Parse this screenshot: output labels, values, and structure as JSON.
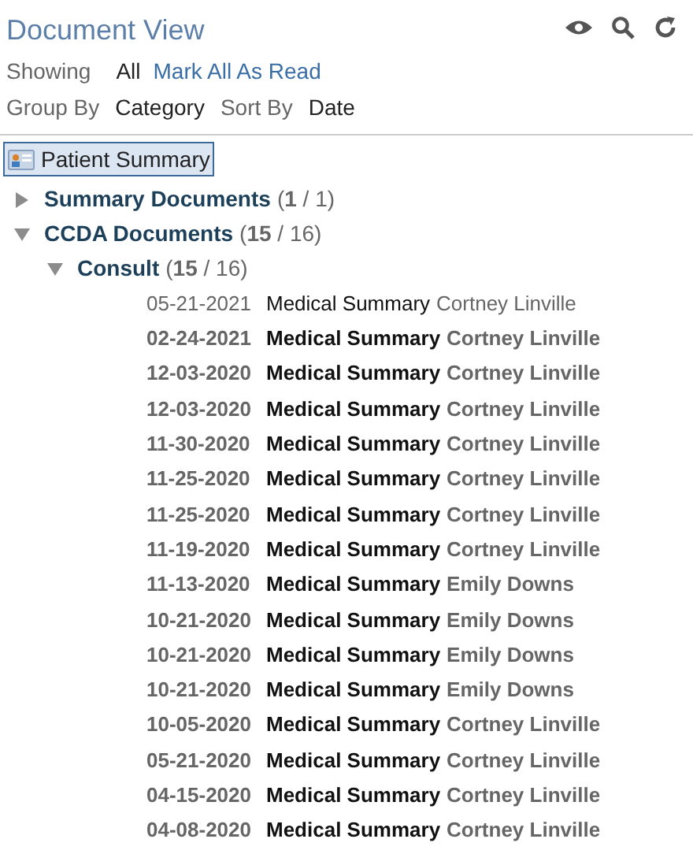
{
  "header": {
    "title": "Document View"
  },
  "filters": {
    "showing_label": "Showing",
    "showing_value": "All",
    "mark_all_link": "Mark All As Read",
    "group_by_label": "Group By",
    "group_by_value": "Category",
    "sort_by_label": "Sort By",
    "sort_by_value": "Date"
  },
  "root": {
    "label": "Patient Summary",
    "selected": true
  },
  "tree": [
    {
      "label": "Summary Documents",
      "count": "(**1** / 1)",
      "expanded": false
    },
    {
      "label": "CCDA Documents",
      "count": "(**15** / 16)",
      "expanded": true,
      "children": [
        {
          "label": "Consult",
          "count": "(**15** / 16)",
          "expanded": true,
          "documents": [
            {
              "date": "05-21-2021",
              "title": "Medical Summary",
              "author": "Cortney Linville",
              "unread": false
            },
            {
              "date": "02-24-2021",
              "title": "Medical Summary",
              "author": "Cortney Linville",
              "unread": true
            },
            {
              "date": "12-03-2020",
              "title": "Medical Summary",
              "author": "Cortney Linville",
              "unread": true
            },
            {
              "date": "12-03-2020",
              "title": "Medical Summary",
              "author": "Cortney Linville",
              "unread": true
            },
            {
              "date": "11-30-2020",
              "title": "Medical Summary",
              "author": "Cortney Linville",
              "unread": true
            },
            {
              "date": "11-25-2020",
              "title": "Medical Summary",
              "author": "Cortney Linville",
              "unread": true
            },
            {
              "date": "11-25-2020",
              "title": "Medical Summary",
              "author": "Cortney Linville",
              "unread": true
            },
            {
              "date": "11-19-2020",
              "title": "Medical Summary",
              "author": "Cortney Linville",
              "unread": true
            },
            {
              "date": "11-13-2020",
              "title": "Medical Summary",
              "author": "Emily Downs",
              "unread": true
            },
            {
              "date": "10-21-2020",
              "title": "Medical Summary",
              "author": "Emily Downs",
              "unread": true
            },
            {
              "date": "10-21-2020",
              "title": "Medical Summary",
              "author": "Emily Downs",
              "unread": true
            },
            {
              "date": "10-21-2020",
              "title": "Medical Summary",
              "author": "Emily Downs",
              "unread": true
            },
            {
              "date": "10-05-2020",
              "title": "Medical Summary",
              "author": "Cortney Linville",
              "unread": true
            },
            {
              "date": "05-21-2020",
              "title": "Medical Summary",
              "author": "Cortney Linville",
              "unread": true
            },
            {
              "date": "04-15-2020",
              "title": "Medical Summary",
              "author": "Cortney Linville",
              "unread": true
            },
            {
              "date": "04-08-2020",
              "title": "Medical Summary",
              "author": "Cortney Linville",
              "unread": true
            }
          ]
        }
      ]
    }
  ]
}
